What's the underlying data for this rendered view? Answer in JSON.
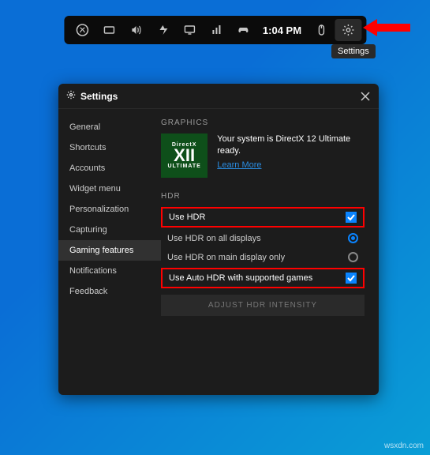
{
  "gamebar": {
    "time": "1:04 PM"
  },
  "tooltip": {
    "settings": "Settings"
  },
  "panel": {
    "title": "Settings",
    "sidebar": {
      "items": [
        {
          "label": "General"
        },
        {
          "label": "Shortcuts"
        },
        {
          "label": "Accounts"
        },
        {
          "label": "Widget menu"
        },
        {
          "label": "Personalization"
        },
        {
          "label": "Capturing"
        },
        {
          "label": "Gaming features"
        },
        {
          "label": "Notifications"
        },
        {
          "label": "Feedback"
        }
      ]
    },
    "graphics": {
      "section": "GRAPHICS",
      "badge_top": "DirectX",
      "badge_mid": "XII",
      "badge_bottom": "ULTIMATE",
      "status": "Your system is DirectX 12 Ultimate ready.",
      "learn": "Learn More"
    },
    "hdr": {
      "section": "HDR",
      "use_hdr": "Use HDR",
      "all_displays": "Use HDR on all displays",
      "main_only": "Use HDR on main display only",
      "auto_hdr": "Use Auto HDR with supported games",
      "adjust": "ADJUST HDR INTENSITY"
    }
  },
  "watermark": "wsxdn.com"
}
